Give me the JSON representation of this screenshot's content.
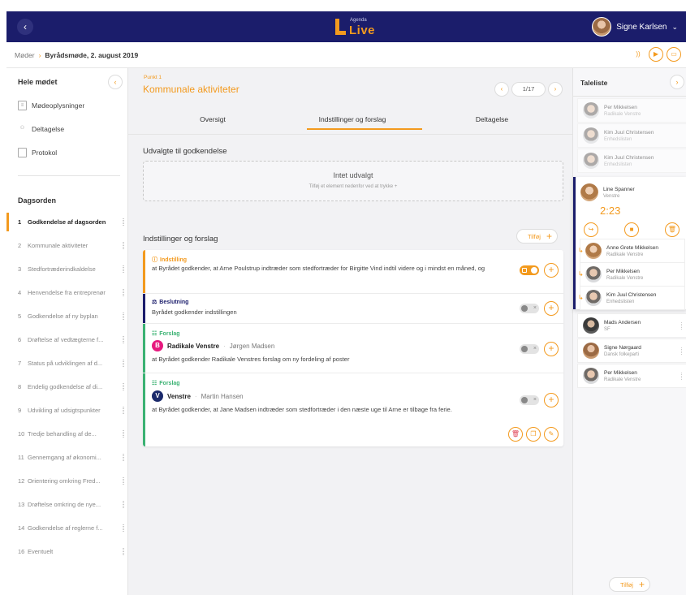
{
  "header": {
    "back_icon": "chevron-left-icon",
    "logo_small": "Agenda",
    "logo_text": "Live",
    "user_name": "Signe Karlsen",
    "accent": "#f39a1e",
    "navy": "#1b1d6b"
  },
  "breadcrumb": {
    "root": "Møder",
    "current": "Byrådsmøde, 2. august 2019"
  },
  "sidebar": {
    "title": "Hele mødet",
    "links": [
      {
        "label": "Mødeoplysninger"
      },
      {
        "label": "Deltagelse"
      },
      {
        "label": "Protokol"
      }
    ],
    "agenda_title": "Dagsorden",
    "agenda": [
      {
        "num": "1",
        "label": "Godkendelse af dagsorden"
      },
      {
        "num": "2",
        "label": "Kommunale aktiviteter"
      },
      {
        "num": "3",
        "label": "Stedfortræderindkaldelse"
      },
      {
        "num": "4",
        "label": "Henvendelse fra entreprenør"
      },
      {
        "num": "5",
        "label": "Godkendelse af ny byplan"
      },
      {
        "num": "6",
        "label": "Drøftelse af vedtægterne f..."
      },
      {
        "num": "7",
        "label": "Status på udviklingen af d..."
      },
      {
        "num": "8",
        "label": "Endelig godkendelse af di..."
      },
      {
        "num": "9",
        "label": "Udvikling af udsigtspunkter"
      },
      {
        "num": "10",
        "label": "Tredje behandling af de..."
      },
      {
        "num": "11",
        "label": "Gennemgang af økonomi..."
      },
      {
        "num": "12",
        "label": "Orientering omkring Fred..."
      },
      {
        "num": "13",
        "label": "Drøftelse omkring de nye..."
      },
      {
        "num": "14",
        "label": "Godkendelse af reglerne f..."
      },
      {
        "num": "16",
        "label": "Eventuelt"
      }
    ]
  },
  "main": {
    "point_label": "Punkt 1",
    "title": "Kommunale aktiviteter",
    "pager": "1/17",
    "tabs": [
      {
        "label": "Oversigt"
      },
      {
        "label": "Indstillinger og forslag"
      },
      {
        "label": "Deltagelse"
      }
    ],
    "selected_title": "Udvalgte til godkendelse",
    "empty_main": "Intet udvalgt",
    "empty_sub": "Tilføj et element nedenfor ved at trykke +",
    "list_title": "Indstillinger og forslag",
    "add_label": "Tilføj",
    "items": [
      {
        "type": "Indstilling",
        "text": "at Byrådet godkender, at Arne Poulstrup indtræder som stedfortræder for Birgitte Vind indtil videre og i mindst en måned, og",
        "color": "#f39a1e"
      },
      {
        "type": "Beslutning",
        "text": "Byrådet godkender indstillingen",
        "color": "#1b1d6b"
      },
      {
        "type": "Forslag",
        "party": "Radikale Venstre",
        "party_letter": "B",
        "person": "Jørgen Madsen",
        "text": "at Byrådet godkender Radikale Venstres forslag om ny fordeling af poster",
        "color": "#3bb273",
        "badge_color": "#e6197e"
      },
      {
        "type": "Forslag",
        "party": "Venstre",
        "party_letter": "V",
        "person": "Martin Hansen",
        "text": "at Byrådet godkender, at Jane Madsen indtræder som stedfortræder i den næste uge til Arne er tilbage fra ferie.",
        "color": "#3bb273",
        "badge_color": "#1b2a6b"
      }
    ]
  },
  "taleliste": {
    "title": "Taleliste",
    "past": [
      {
        "name": "Per Mikkelsen",
        "party": "Radikale Venstre"
      },
      {
        "name": "Kim Juul Christensen",
        "party": "Enhedslisten"
      },
      {
        "name": "Kim Juul Christensen",
        "party": "Enhedslisten"
      }
    ],
    "current": {
      "name": "Line Spanner",
      "party": "Venstre",
      "timer": "2:23"
    },
    "replies": [
      {
        "name": "Anne Grete Mikkelsen",
        "party": "Radikale Venstre"
      },
      {
        "name": "Per Mikkelsen",
        "party": "Radikale Venstre"
      },
      {
        "name": "Kim Juul Christensen",
        "party": "Enhedslisten"
      }
    ],
    "queue": [
      {
        "name": "Mads Andersen",
        "party": "SF"
      },
      {
        "name": "Signe Nørgaard",
        "party": "Dansk folkeparti"
      },
      {
        "name": "Per Mikkelsen",
        "party": "Radikale Venstre"
      }
    ],
    "add_label": "Tilføj"
  }
}
